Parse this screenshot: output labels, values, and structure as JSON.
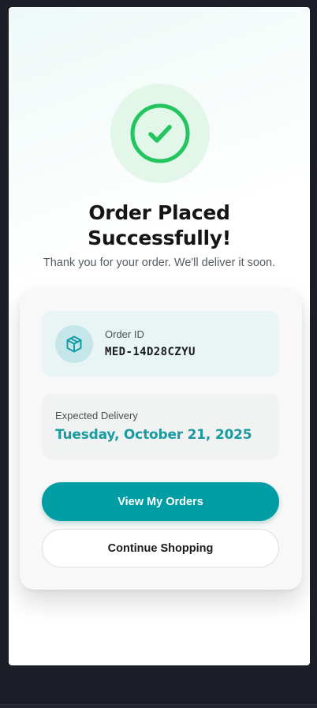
{
  "success": {
    "icon": "check-circle-icon",
    "title_line1": "Order Placed",
    "title_line2": "Successfully!",
    "subtitle": "Thank you for your order. We'll deliver it soon."
  },
  "order": {
    "icon": "package-icon",
    "label": "Order ID",
    "value": "MED-14D28CZYU"
  },
  "delivery": {
    "label": "Expected Delivery",
    "value": "Tuesday, October 21, 2025"
  },
  "actions": {
    "primary_label": "View My Orders",
    "secondary_label": "Continue Shopping"
  },
  "colors": {
    "accent": "#009ea4",
    "success": "#22c55e",
    "delivery_text": "#1a9aa1"
  }
}
